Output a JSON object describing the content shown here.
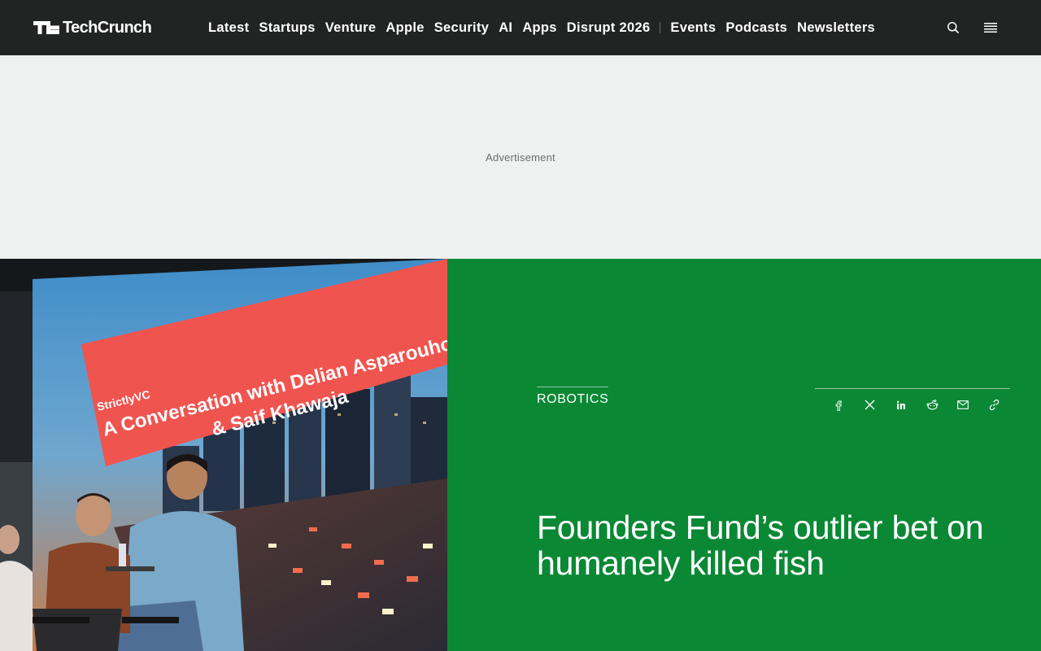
{
  "header": {
    "logo_text": "TechCrunch",
    "nav_primary": [
      "Latest",
      "Startups",
      "Venture",
      "Apple",
      "Security",
      "AI",
      "Apps",
      "Disrupt 2026"
    ],
    "nav_secondary": [
      "Events",
      "Podcasts",
      "Newsletters"
    ],
    "icons": {
      "search": "search-icon",
      "menu": "hamburger-menu-icon"
    }
  },
  "ad": {
    "label": "Advertisement"
  },
  "article": {
    "category": "ROBOTICS",
    "headline": "Founders Fund’s outlier bet on humanely killed fish",
    "share_icons": [
      "facebook-icon",
      "x-icon",
      "linkedin-icon",
      "reddit-icon",
      "email-icon",
      "link-icon"
    ]
  },
  "hero_image": {
    "screen_lines": [
      "A Conversation with Delian Asparouhov",
      "& Saif Khawaja"
    ],
    "screen_brand": "StrictlyVC"
  },
  "colors": {
    "header_bg": "#222423",
    "ad_bg": "#edf1f0",
    "panel_green": "#0a8834",
    "screen_red": "#f0544f"
  }
}
